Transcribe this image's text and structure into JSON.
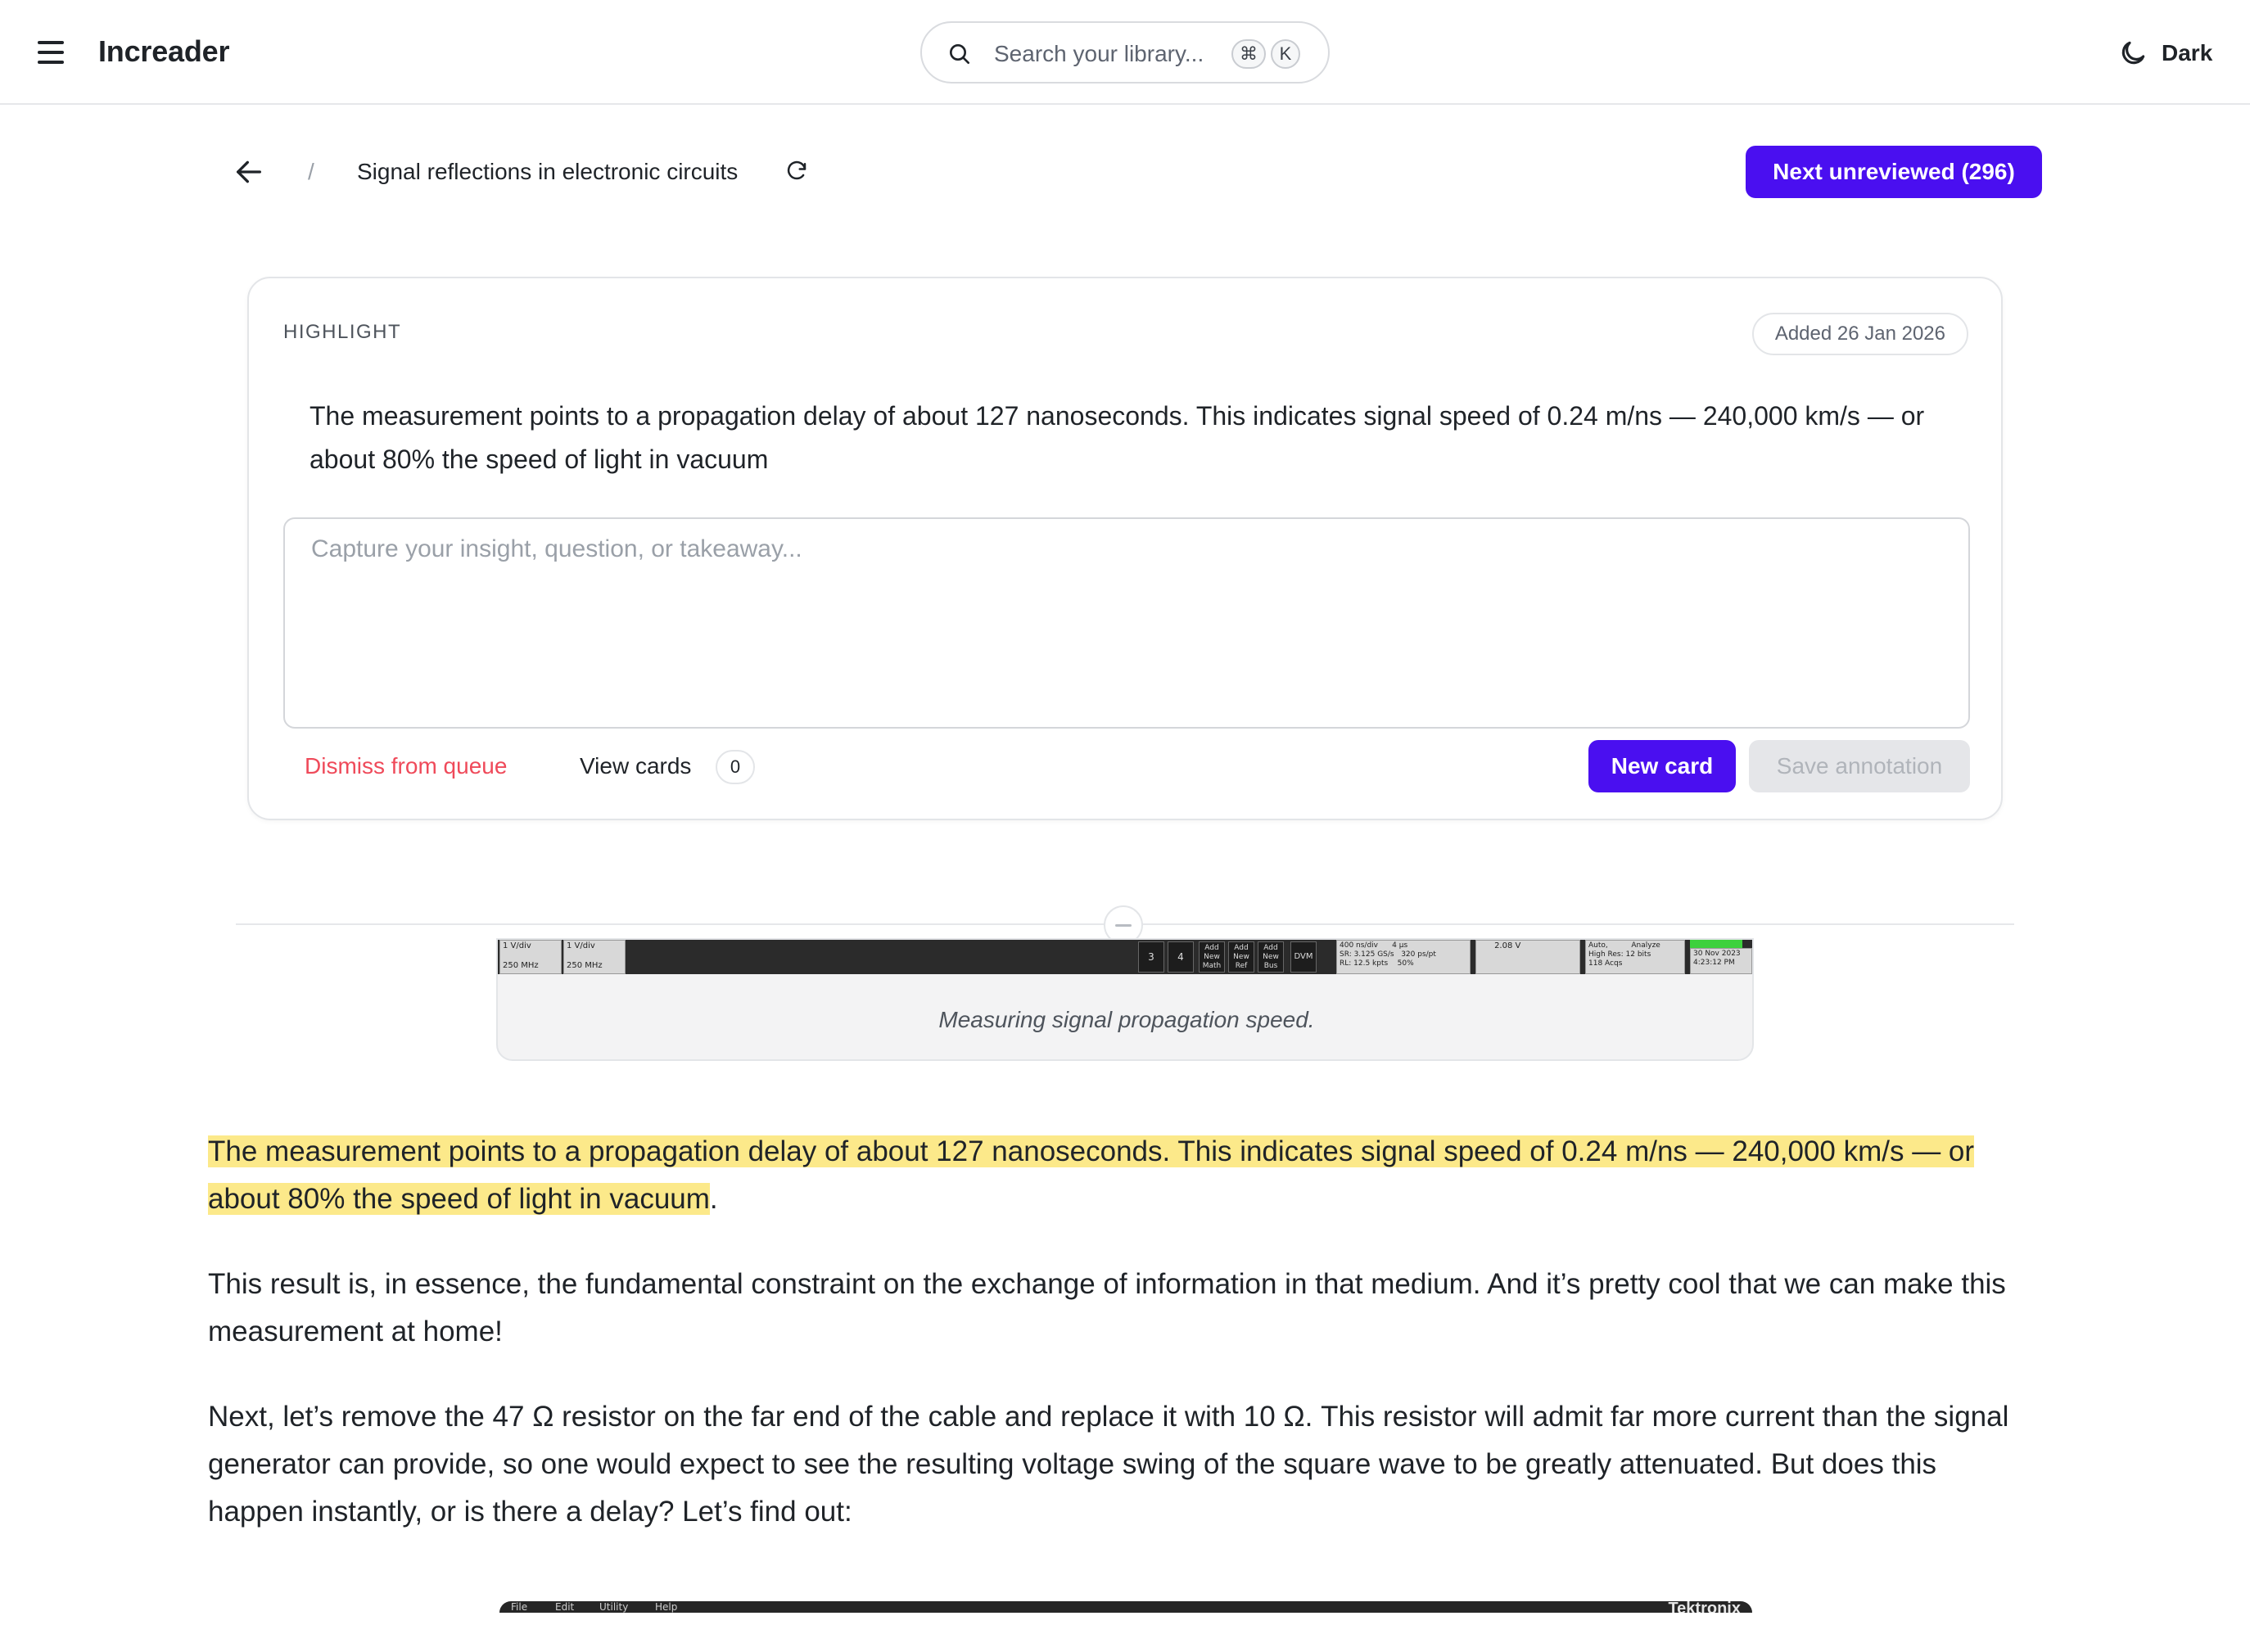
{
  "app": {
    "title": "Increader"
  },
  "search": {
    "placeholder": "Search your library...",
    "shortcut_keys": [
      "⌘",
      "K"
    ]
  },
  "theme": {
    "label": "Dark"
  },
  "header": {
    "breadcrumb_separator": "/",
    "doc_title": "Signal reflections in electronic circuits",
    "next_button": "Next unreviewed (296)"
  },
  "highlight_card": {
    "label": "HIGHLIGHT",
    "added": "Added 26 Jan 2026",
    "quote": "The measurement points to a propagation delay of about 127 nanoseconds. This indicates signal speed of 0.24 m/ns — 240,000 km/s — or about 80% the speed of light in vacuum",
    "note_placeholder": "Capture your insight, question, or takeaway...",
    "dismiss": "Dismiss from queue",
    "view_cards": "View cards",
    "cards_count": "0",
    "new_card": "New card",
    "save_annotation": "Save annotation"
  },
  "figure": {
    "caption": "Measuring signal propagation speed.",
    "scope": {
      "ch1": "1 V/div\n\n250 MHz",
      "ch2": "1 V/div\n\n250 MHz",
      "key3": "3",
      "key4": "4",
      "add_math": "Add\nNew\nMath",
      "add_ref": "Add\nNew\nRef",
      "add_bus": "Add\nNew\nBus",
      "dvm": "DVM",
      "horizontal": "400 ns/div      4 µs\nSR: 3.125 GS/s   320 ps/pt\nRL: 12.5 kpts    50%",
      "trigger": "      2.08 V",
      "acq": "Auto,          Analyze\nHigh Res: 12 bits\n118 Acqs",
      "datetime": "30 Nov 2023\n4:23:12 PM"
    }
  },
  "article": {
    "p1_highlight": "The measurement points to a propagation delay of about 127 nanoseconds. This indicates signal speed of 0.24 m/ns — 240,000 km/s — or about 80% the speed of light in vacuum",
    "p1_tail": ".",
    "p2": "This result is, in essence, the fundamental constraint on the exchange of information in that medium. And it’s pretty cool that we can make this measurement at home!",
    "p3": "Next, let’s remove the 47 Ω resistor on the far end of the cable and replace it with 10 Ω. This resistor will admit far more current than the signal generator can provide, so one would expect to see the resulting voltage swing of the square wave to be greatly attenuated. But does this happen instantly, or is there a delay? Let’s find out:"
  },
  "bottom_image": {
    "menu": [
      "File",
      "Edit",
      "Utility",
      "Help"
    ],
    "brand": "Tektronix"
  },
  "colors": {
    "accent": "#4a0ff0",
    "danger": "#ef4a5a",
    "highlight": "#fce98a"
  }
}
